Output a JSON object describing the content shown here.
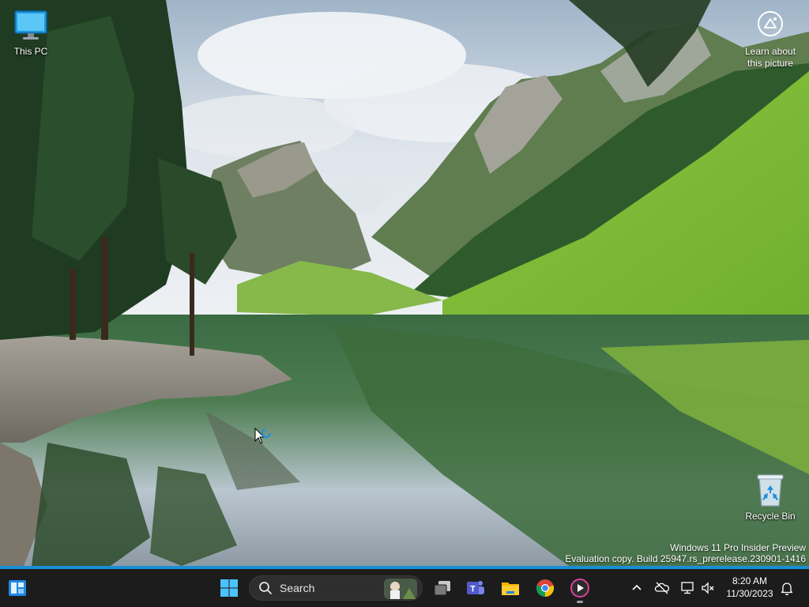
{
  "desktop": {
    "icons": [
      {
        "label": "This PC",
        "icon": "monitor-icon"
      },
      {
        "label": "Recycle Bin",
        "icon": "recycle-bin-icon"
      }
    ],
    "spotlight": {
      "label_line1": "Learn about",
      "label_line2": "this picture",
      "icon": "camera-info-icon"
    },
    "watermark": {
      "line1": "Windows 11 Pro Insider Preview",
      "line2": "Evaluation copy. Build 25947.rs_prerelease.230901-1416"
    }
  },
  "taskbar": {
    "widgets_icon": "widgets-icon",
    "start_icon": "windows-start-icon",
    "search": {
      "label": "Search",
      "icon": "search-icon"
    },
    "pinned": [
      {
        "name": "Task View",
        "icon": "task-view-icon"
      },
      {
        "name": "Microsoft Teams",
        "icon": "teams-icon"
      },
      {
        "name": "File Explorer",
        "icon": "file-explorer-icon"
      },
      {
        "name": "Google Chrome",
        "icon": "chrome-icon"
      },
      {
        "name": "Media Player",
        "icon": "media-player-icon",
        "running": true
      }
    ],
    "tray": {
      "icons": [
        "chevron-up-icon",
        "onedrive-offline-icon",
        "network-icon",
        "volume-muted-icon"
      ],
      "time": "8:20 AM",
      "date": "11/30/2023",
      "notification_icon": "bell-icon"
    }
  },
  "colors": {
    "taskbar": "#1c1c1c",
    "accent_line": "#1a8fd6",
    "search_box": "#2e2e2e"
  }
}
